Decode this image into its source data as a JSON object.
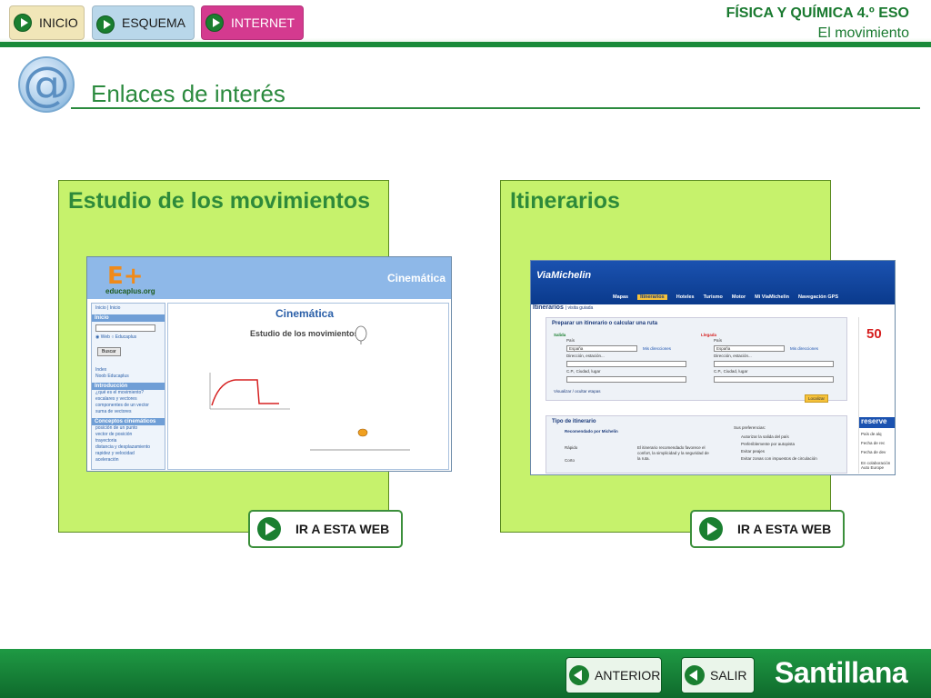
{
  "nav": {
    "inicio": "INICIO",
    "esquema": "ESQUEMA",
    "internet": "INTERNET"
  },
  "header": {
    "subject": "FÍSICA Y QUÍMICA 4.º ESO",
    "unit": "El movimiento"
  },
  "page": {
    "title": "Enlaces de interés"
  },
  "cards": [
    {
      "title": "Estudio de los movimientos",
      "button_label": "IR A ESTA WEB",
      "thumbnail": {
        "site_logo": "E+",
        "site_logo_sub": "educaplus.org",
        "header_text": "Cinemática",
        "main_title": "Cinemática",
        "main_subtitle": "Estudio de los movimientos",
        "sidebar": {
          "top_links": "Inicio | Inicio",
          "search_section": "Inicio",
          "radio_web": "Web",
          "radio_educaplus": "Educaplus",
          "search_button": "Buscar",
          "links_1": [
            "Index",
            "Noob Educaplus"
          ],
          "section_intro": "Introducción",
          "links_2": [
            "¿qué es el movimiento?",
            "escalares y vectores",
            "componentes de un vector",
            "suma de vectores"
          ],
          "section_concepts": "Conceptos cinemáticos",
          "links_3": [
            "posición de un punto",
            "vector de posición",
            "trayectoria",
            "distancia y desplazamiento",
            "rapidez y velocidad",
            "aceleración"
          ]
        }
      }
    },
    {
      "title": "Itinerarios",
      "button_label": "IR A ESTA WEB",
      "thumbnail": {
        "site_logo": "ViaMichelin",
        "menu": [
          "Mapas",
          "Itinerarios",
          "Hoteles",
          "Turismo",
          "Motor",
          "Mi ViaMichelin",
          "Navegación GPS"
        ],
        "section": "Itinerarios",
        "section_link": "| visita guiada",
        "form_title": "Preparar un itinerario o calcular una ruta",
        "salida": "Salida",
        "llegada": "Llegada",
        "pais": "País",
        "pais_value": "España",
        "mis_direcciones": "Mis direcciones",
        "direccion": "Dirección, estación...",
        "cp": "C.P., Ciudad, lugar",
        "visualizar": "Visualizar / ocultar etapas",
        "localizar": "Localizar",
        "tipo": "Tipo de itinerario",
        "opt1": "Recomendado por Michelin",
        "opt2": "Rápido",
        "opt3": "Corto",
        "desc": "El itinerario recomendado favorece el confort, la simplicidad y la seguridad de la ruta.",
        "prefs_title": "Sus preferencias:",
        "prefs": [
          "Autorizar la salida del país",
          "Preferiblemente por autopista",
          "Evitar peajes",
          "Evitar zonas con impuestos de circulación"
        ],
        "promo": "50",
        "reserve": "reserve",
        "side_lines": [
          "País de alq",
          "Fecha de rec",
          "Fecha de dev",
          "En colaboración Auto Europe"
        ]
      }
    }
  ],
  "footer": {
    "anterior": "ANTERIOR",
    "salir": "SALIR",
    "brand": "Santillana"
  },
  "colors": {
    "green": "#1a8a3a",
    "card_bg": "#c6f26c",
    "internet_btn": "#d43a8f"
  }
}
